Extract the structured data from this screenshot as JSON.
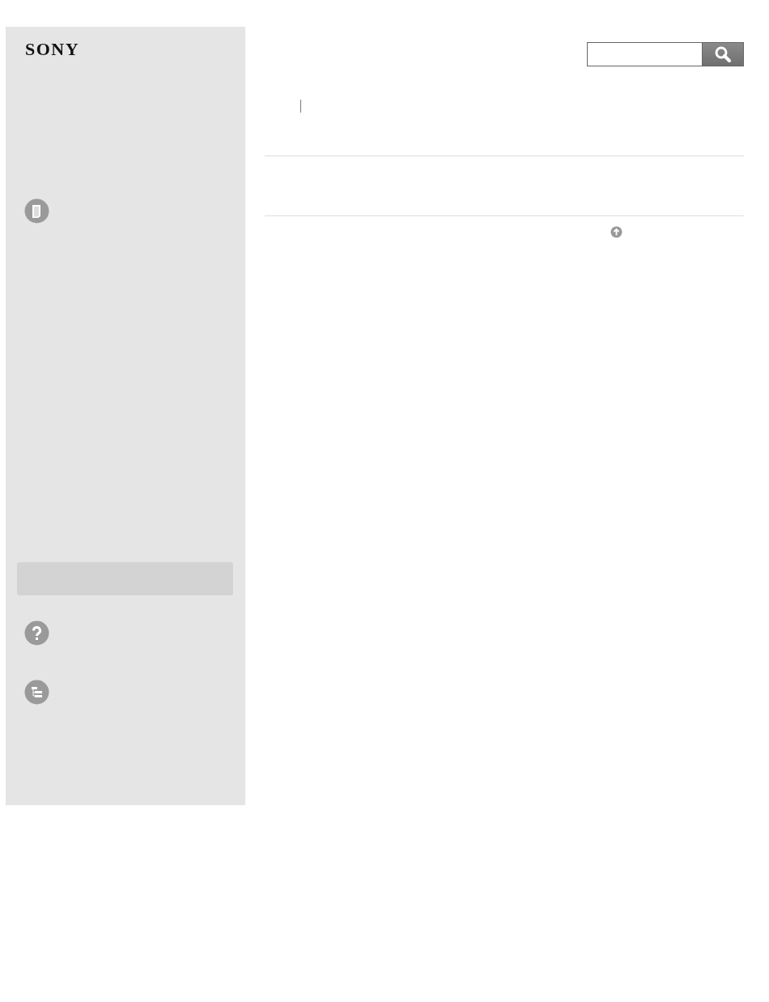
{
  "logo": {
    "text": "SONY"
  }
}
